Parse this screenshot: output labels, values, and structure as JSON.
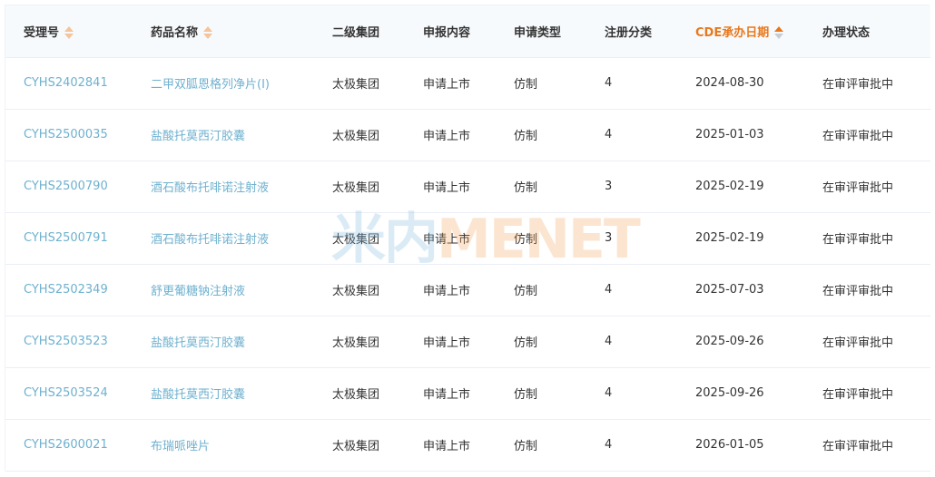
{
  "table": {
    "columns": [
      {
        "label": "受理号",
        "sortable": true,
        "sort": "none"
      },
      {
        "label": "药品名称",
        "sortable": true,
        "sort": "none"
      },
      {
        "label": "二级集团",
        "sortable": false
      },
      {
        "label": "申报内容",
        "sortable": false
      },
      {
        "label": "申请类型",
        "sortable": false
      },
      {
        "label": "注册分类",
        "sortable": false
      },
      {
        "label": "CDE承办日期",
        "sortable": true,
        "sort": "asc"
      },
      {
        "label": "办理状态",
        "sortable": false
      }
    ],
    "rows": [
      {
        "accept_no": "CYHS2402841",
        "drug_name": "二甲双胍恩格列净片(Ⅰ)",
        "group": "太极集团",
        "content": "申请上市",
        "type": "仿制",
        "category": "4",
        "date": "2024-08-30",
        "status": "在审评审批中"
      },
      {
        "accept_no": "CYHS2500035",
        "drug_name": "盐酸托莫西汀胶囊",
        "group": "太极集团",
        "content": "申请上市",
        "type": "仿制",
        "category": "4",
        "date": "2025-01-03",
        "status": "在审评审批中"
      },
      {
        "accept_no": "CYHS2500790",
        "drug_name": "酒石酸布托啡诺注射液",
        "group": "太极集团",
        "content": "申请上市",
        "type": "仿制",
        "category": "3",
        "date": "2025-02-19",
        "status": "在审评审批中"
      },
      {
        "accept_no": "CYHS2500791",
        "drug_name": "酒石酸布托啡诺注射液",
        "group": "太极集团",
        "content": "申请上市",
        "type": "仿制",
        "category": "3",
        "date": "2025-02-19",
        "status": "在审评审批中"
      },
      {
        "accept_no": "CYHS2502349",
        "drug_name": "舒更葡糖钠注射液",
        "group": "太极集团",
        "content": "申请上市",
        "type": "仿制",
        "category": "4",
        "date": "2025-07-03",
        "status": "在审评审批中"
      },
      {
        "accept_no": "CYHS2503523",
        "drug_name": "盐酸托莫西汀胶囊",
        "group": "太极集团",
        "content": "申请上市",
        "type": "仿制",
        "category": "4",
        "date": "2025-09-26",
        "status": "在审评审批中"
      },
      {
        "accept_no": "CYHS2503524",
        "drug_name": "盐酸托莫西汀胶囊",
        "group": "太极集团",
        "content": "申请上市",
        "type": "仿制",
        "category": "4",
        "date": "2025-09-26",
        "status": "在审评审批中"
      },
      {
        "accept_no": "CYHS2600021",
        "drug_name": "布瑞哌唑片",
        "group": "太极集团",
        "content": "申请上市",
        "type": "仿制",
        "category": "4",
        "date": "2026-01-05",
        "status": "在审评审批中"
      }
    ]
  },
  "watermark": {
    "cn": "米内",
    "en": "MENET"
  },
  "colors": {
    "header_bg": "#f7fafd",
    "active_sort": "#e8781c",
    "link": "#6fb1cf",
    "text": "#333333",
    "border": "#ebeef5"
  },
  "icons": {
    "sort": "sort-caret-icon"
  }
}
